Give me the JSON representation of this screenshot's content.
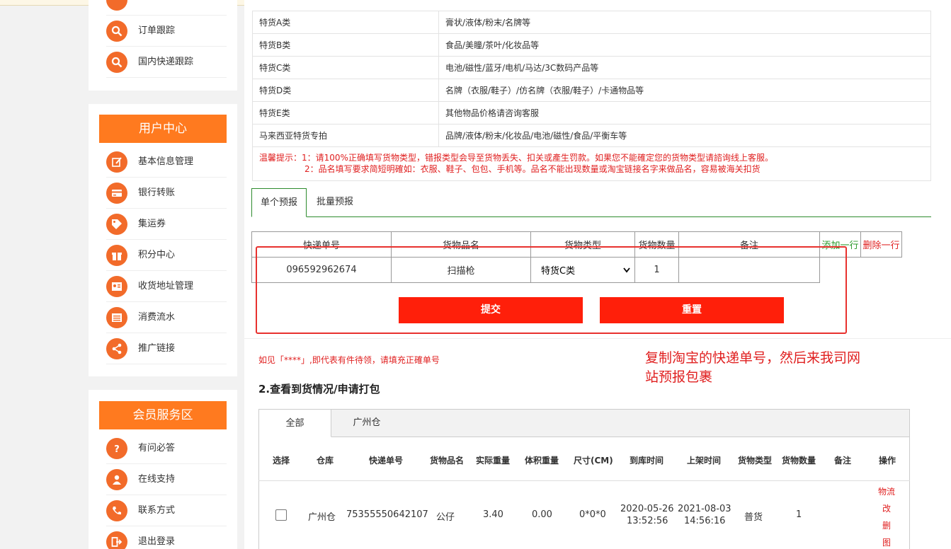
{
  "sidebar": {
    "top_items": [
      {
        "label": "订单跟踪",
        "icon": "search-icon"
      },
      {
        "label": "国内快递跟踪",
        "icon": "search-icon"
      }
    ],
    "user_center": {
      "title": "用户中心",
      "items": [
        {
          "label": "基本信息管理",
          "icon": "edit-icon"
        },
        {
          "label": "银行转账",
          "icon": "card-icon"
        },
        {
          "label": "集运券",
          "icon": "tag-icon"
        },
        {
          "label": "积分中心",
          "icon": "gift-icon"
        },
        {
          "label": "收货地址管理",
          "icon": "id-card-icon"
        },
        {
          "label": "消费流水",
          "icon": "list-icon"
        },
        {
          "label": "推广链接",
          "icon": "share-icon"
        }
      ]
    },
    "member_service": {
      "title": "会员服务区",
      "items": [
        {
          "label": "有问必答",
          "icon": "question-icon"
        },
        {
          "label": "在线支持",
          "icon": "user-icon"
        },
        {
          "label": "联系方式",
          "icon": "phone-icon"
        },
        {
          "label": "退出登录",
          "icon": "logout-icon"
        }
      ]
    }
  },
  "categories": [
    {
      "name": "特货A类",
      "desc": "膏状/液体/粉末/名牌等"
    },
    {
      "name": "特货B类",
      "desc": "食品/美瞳/茶叶/化妆品等"
    },
    {
      "name": "特货C类",
      "desc": "电池/磁性/蓝牙/电机/马达/3C数码产品等"
    },
    {
      "name": "特货D类",
      "desc": "名牌（衣服/鞋子）/仿名牌（衣服/鞋子）/卡通物品等"
    },
    {
      "name": "特货E类",
      "desc": "其他物品价格请咨询客服"
    },
    {
      "name": "马来西亚特货专拍",
      "desc": "品牌/液体/粉末/化妆品/电池/磁性/食品/平衡车等"
    }
  ],
  "tips": {
    "line1": "温馨提示：1：请100%正确填写货物类型，错报类型会导至货物丢失、扣关或產生罚款。如果您不能確定您的货物类型请諮询线上客服。",
    "line2": "2：品名填写要求简短明確如：衣服、鞋子、包包、手机等。品名不能出现数量或淘宝链接名字来做品名，容易被海关扣货"
  },
  "forecast_tabs": [
    "单个预报",
    "批量预报"
  ],
  "form": {
    "headers": [
      "快递单号",
      "货物品名",
      "货物类型",
      "货物数量",
      "备注"
    ],
    "add_row": "添加一行",
    "delete_row": "删除一行",
    "tracking_no": "096592962674",
    "item_name": "扫描枪",
    "item_type": "特货C类",
    "quantity": "1",
    "remark": "",
    "submit": "提交",
    "reset": "重置"
  },
  "notice": "如见「****」,即代表有件待领，请填充正確单号",
  "annotation": "复制淘宝的快递单号，然后来我司网站预报包裹",
  "section_title": "2.查看到货情况/申请打包",
  "warehouse_tabs": [
    "全部",
    "广州仓"
  ],
  "list": {
    "headers": [
      "选择",
      "仓库",
      "快递单号",
      "货物品名",
      "实际重量",
      "体积重量",
      "尺寸(CM)",
      "到库时间",
      "上架时间",
      "货物类型",
      "货物数量",
      "备注",
      "操作"
    ],
    "row": {
      "warehouse": "广州仓",
      "tracking_no": "75355550642107",
      "item_name": "公仔",
      "actual_weight": "3.40",
      "volume_weight": "0.00",
      "size": "0*0*0",
      "arrive_date": "2020-05-26",
      "arrive_time": "13:52:56",
      "shelf_date": "2021-08-03",
      "shelf_time": "14:56:16",
      "type": "普货",
      "qty": "1",
      "remark": "",
      "ops": [
        "物流",
        "改",
        "删",
        "图"
      ]
    }
  },
  "colors": {
    "accent": "#ff7a1f",
    "icon": "#f26b2a",
    "danger": "#ff1f0a",
    "tab_green": "#2e8b2e"
  }
}
